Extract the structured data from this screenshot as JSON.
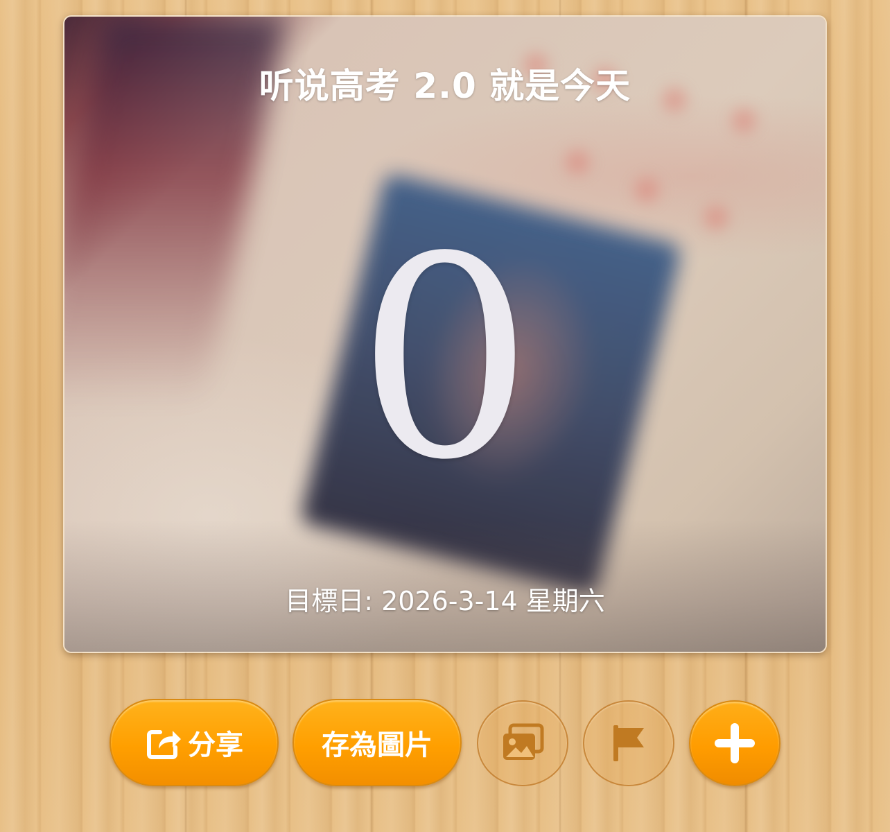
{
  "card": {
    "title": "听说高考 2.0 就是今天",
    "count": "0",
    "target_date": "目標日: 2026-3-14 星期六",
    "background": "blurred-id-photo-on-paper"
  },
  "toolbar": {
    "share": {
      "label": "分享",
      "icon": "share-icon"
    },
    "save_image": {
      "label": "存為圖片"
    },
    "photo": {
      "icon": "photo-icon"
    },
    "flag": {
      "icon": "flag-icon"
    },
    "add": {
      "icon": "plus-icon"
    }
  },
  "colors": {
    "accent": "#ff9f00",
    "ghost_button_icon": "#c07a22",
    "text_on_card": "#ffffff"
  }
}
